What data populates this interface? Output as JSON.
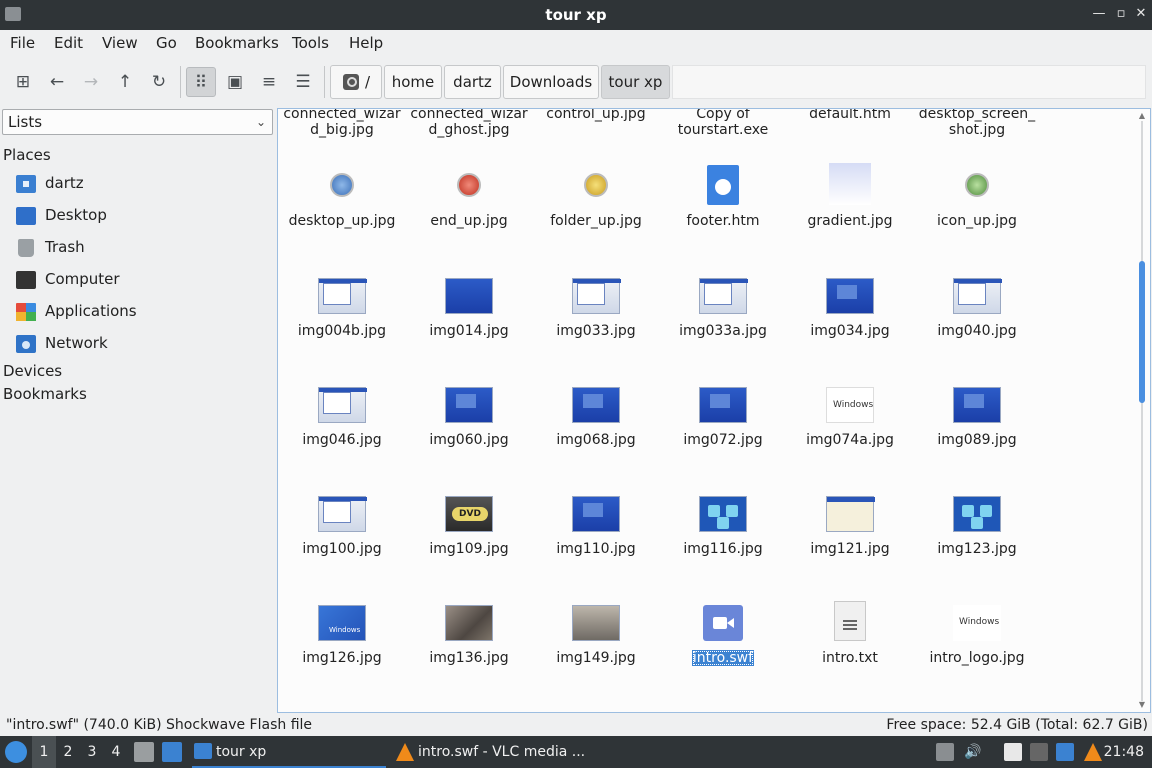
{
  "window": {
    "title": "tour xp"
  },
  "menu": [
    "File",
    "Edit",
    "View",
    "Go",
    "Bookmarks",
    "Tools",
    "Help"
  ],
  "path": {
    "root": "/",
    "crumbs": [
      "home",
      "dartz",
      "Downloads",
      "tour xp"
    ]
  },
  "sidebar": {
    "dropdown": "Lists",
    "places_header": "Places",
    "places": [
      {
        "label": "dartz",
        "icon": "home-folder-icon"
      },
      {
        "label": "Desktop",
        "icon": "desktop-icon"
      },
      {
        "label": "Trash",
        "icon": "trash-icon"
      },
      {
        "label": "Computer",
        "icon": "computer-icon"
      },
      {
        "label": "Applications",
        "icon": "applications-icon"
      },
      {
        "label": "Network",
        "icon": "network-icon"
      }
    ],
    "devices_header": "Devices",
    "bookmarks_header": "Bookmarks"
  },
  "files": {
    "top_row": [
      {
        "line1": "connected_wizar",
        "line2": "d_big.jpg"
      },
      {
        "line1": "connected_wizar",
        "line2": "d_ghost.jpg"
      },
      {
        "line1": "control_up.jpg",
        "line2": ""
      },
      {
        "line1": "Copy of",
        "line2": "tourstart.exe"
      },
      {
        "line1": "default.htm",
        "line2": ""
      },
      {
        "line1": "desktop_screen_",
        "line2": "shot.jpg"
      }
    ],
    "rows": [
      [
        "desktop_up.jpg",
        "end_up.jpg",
        "folder_up.jpg",
        "footer.htm",
        "gradient.jpg",
        "icon_up.jpg"
      ],
      [
        "img004b.jpg",
        "img014.jpg",
        "img033.jpg",
        "img033a.jpg",
        "img034.jpg",
        "img040.jpg"
      ],
      [
        "img046.jpg",
        "img060.jpg",
        "img068.jpg",
        "img072.jpg",
        "img074a.jpg",
        "img089.jpg"
      ],
      [
        "img100.jpg",
        "img109.jpg",
        "img110.jpg",
        "img116.jpg",
        "img121.jpg",
        "img123.jpg"
      ],
      [
        "img126.jpg",
        "img136.jpg",
        "img149.jpg",
        "intro.swf",
        "intro.txt",
        "intro_logo.jpg"
      ]
    ],
    "selected": "intro.swf"
  },
  "status": {
    "left": "\"intro.swf\" (740.0 KiB) Shockwave Flash file",
    "right": "Free space: 52.4 GiB (Total: 62.7 GiB)"
  },
  "taskbar": {
    "workspaces": [
      "1",
      "2",
      "3",
      "4"
    ],
    "tasks": [
      "tour xp",
      "intro.swf - VLC media ..."
    ],
    "clock": "21:48"
  }
}
